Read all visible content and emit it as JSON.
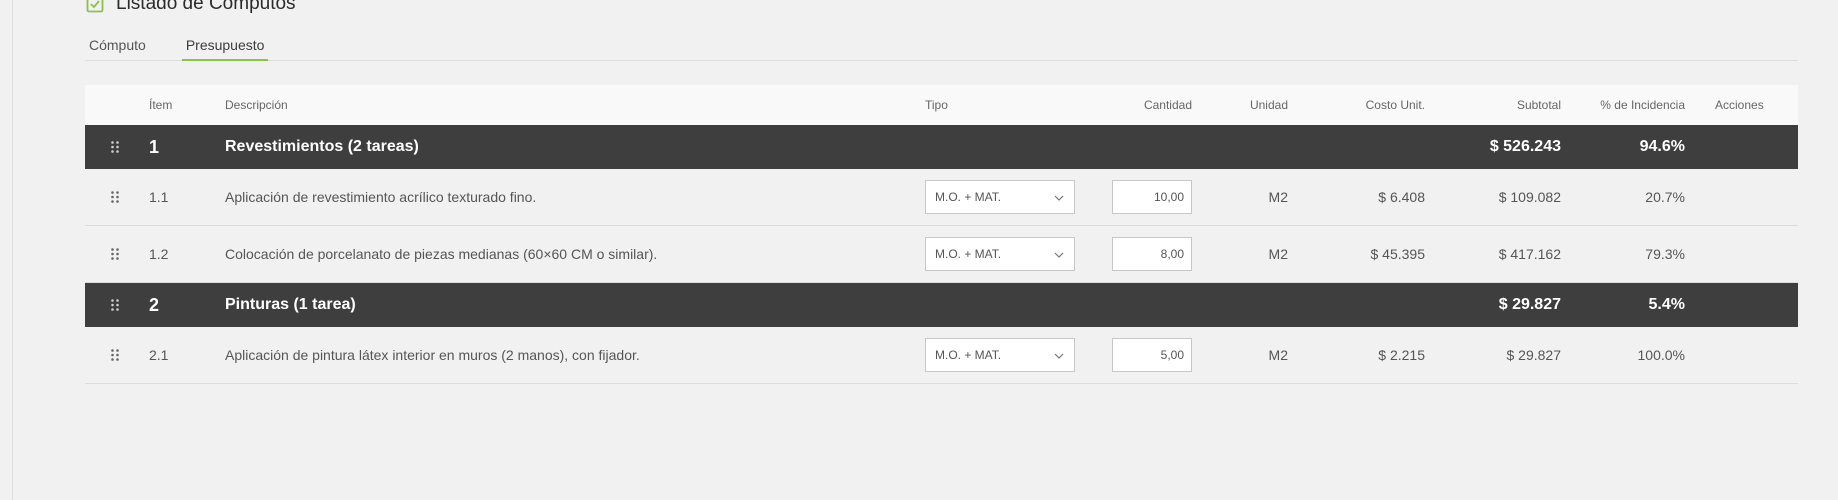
{
  "header": {
    "title": "Listado de Computos",
    "icon": "checkbox-icon",
    "accent": "#8bc34a"
  },
  "tabs": [
    {
      "label": "Cómputo",
      "active": false
    },
    {
      "label": "Presupuesto",
      "active": true
    }
  ],
  "table": {
    "columns": {
      "item": "Ítem",
      "descripcion": "Descripción",
      "tipo": "Tipo",
      "cantidad": "Cantidad",
      "unidad": "Unidad",
      "costo": "Costo Unit.",
      "subtotal": "Subtotal",
      "incidencia": "% de Incidencia",
      "acciones": "Acciones"
    },
    "groups": [
      {
        "item": "1",
        "name": "Revestimientos (2 tareas)",
        "subtotal": "$ 526.243",
        "incidencia": "94.6%",
        "tasks": [
          {
            "item": "1.1",
            "descripcion": "Aplicación de revestimiento acrílico texturado fino.",
            "tipo": "M.O. + MAT.",
            "cantidad": "10,00",
            "unidad": "M2",
            "costo": "$ 6.408",
            "subtotal": "$ 109.082",
            "incidencia": "20.7%"
          },
          {
            "item": "1.2",
            "descripcion": "Colocación de porcelanato de piezas medianas (60×60 CM o similar).",
            "tipo": "M.O. + MAT.",
            "cantidad": "8,00",
            "unidad": "M2",
            "costo": "$ 45.395",
            "subtotal": "$ 417.162",
            "incidencia": "79.3%"
          }
        ]
      },
      {
        "item": "2",
        "name": "Pinturas (1 tarea)",
        "subtotal": "$ 29.827",
        "incidencia": "5.4%",
        "tasks": [
          {
            "item": "2.1",
            "descripcion": "Aplicación de pintura látex interior en muros (2 manos), con fijador.",
            "tipo": "M.O. + MAT.",
            "cantidad": "5,00",
            "unidad": "M2",
            "costo": "$ 2.215",
            "subtotal": "$ 29.827",
            "incidencia": "100.0%"
          }
        ]
      }
    ]
  },
  "colors": {
    "group_row_bg": "#3e3e3e",
    "page_bg": "#f1f1f1",
    "header_bg": "#f9f9f9"
  },
  "icons": {
    "drag_handle": "drag-handle-icon",
    "dropdown": "chevron-down-icon"
  }
}
